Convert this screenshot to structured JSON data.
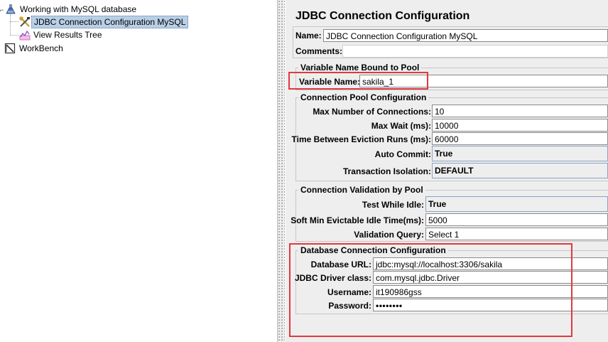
{
  "tree": {
    "root_label": "Working with MySQL database",
    "items": [
      {
        "label": "JDBC Connection Configuration MySQL",
        "icon": "wrench-screwdriver-icon",
        "selected": true
      },
      {
        "label": "View Results Tree",
        "icon": "chart-icon",
        "selected": false
      }
    ],
    "workbench_label": "WorkBench"
  },
  "config": {
    "title": "JDBC Connection Configuration",
    "name_label": "Name:",
    "name_value": "JDBC Connection Configuration MySQL",
    "comments_label": "Comments:",
    "variable_group": {
      "title": "Variable Name Bound to Pool",
      "variable_label": "Variable Name:",
      "variable_value": "sakila_1"
    },
    "pool_group": {
      "title": "Connection Pool Configuration",
      "max_connections_label": "Max Number of Connections:",
      "max_connections_value": "10",
      "max_wait_label": "Max Wait (ms):",
      "max_wait_value": "10000",
      "eviction_label": "Time Between Eviction Runs (ms):",
      "eviction_value": "60000",
      "auto_commit_label": "Auto Commit:",
      "auto_commit_value": "True",
      "isolation_label": "Transaction Isolation:",
      "isolation_value": "DEFAULT"
    },
    "validation_group": {
      "title": "Connection Validation by Pool",
      "test_idle_label": "Test While Idle:",
      "test_idle_value": "True",
      "soft_min_label": "Soft Min Evictable Idle Time(ms):",
      "soft_min_value": "5000",
      "query_label": "Validation Query:",
      "query_value": "Select 1"
    },
    "db_group": {
      "title": "Database Connection Configuration",
      "url_label": "Database URL:",
      "url_value": "jdbc:mysql://localhost:3306/sakila",
      "driver_label": "JDBC Driver class:",
      "driver_value": "com.mysql.jdbc.Driver",
      "username_label": "Username:",
      "username_value": "it190986gss",
      "password_label": "Password:",
      "password_value": "••••••••"
    }
  },
  "colors": {
    "highlight_box": "#e0393f",
    "selection": "#b8cfe5",
    "panel_bg": "#eeeeee"
  }
}
